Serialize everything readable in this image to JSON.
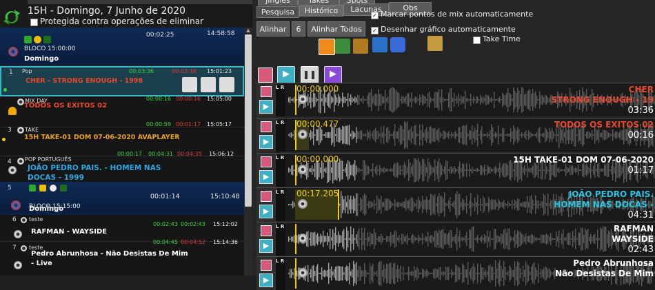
{
  "header": {
    "title": "15H - Domingo, 7 Junho de 2020",
    "protect_label": "Protegida contra operações de eliminar",
    "header_time": "14:58:58"
  },
  "playlist": [
    {
      "kind": "block",
      "dur": "00:02:25",
      "start": "15:00:00",
      "title": "BLOCO 15:00:00",
      "sub": "Domingo"
    },
    {
      "kind": "song",
      "num": "1",
      "cat": "Pop",
      "title": "CHER - STRONG ENOUGH - 1998",
      "color": "#e8492c",
      "t1": "00:03:36",
      "t2": "00:03:38",
      "t3": "15:01:23",
      "selected": true
    },
    {
      "kind": "song",
      "num": "2",
      "cat": "MIX DAY",
      "title": "TODOS OS EXITOS 02",
      "color": "#e8492c",
      "t1": "00:00:16",
      "t2": "00:00:16",
      "t3": "15:05:00"
    },
    {
      "kind": "song",
      "num": "3",
      "cat": "TAKE",
      "title": "15H TAKE-01 DOM 07-06-2020 AVAPLAYER",
      "color": "#e8a21c",
      "t1": "00:00:59",
      "t2": "00:01:17",
      "t3": "15:05:17"
    },
    {
      "kind": "song",
      "num": "4",
      "cat": "POP PORTUGUÊS",
      "title": "JOÃO PEDRO PAIS. - HOMEM NAS DOCAS - 1999",
      "color": "#27a8e0",
      "t1": "00:00:17",
      "t2": "00:04:31",
      "t3": "00:04:35",
      "t4": "15:06:12"
    },
    {
      "kind": "block",
      "num": "5",
      "dur": "00:01:14",
      "start": "15:10:48",
      "title": "BLOCO 15:15:00",
      "sub": "Domingo"
    },
    {
      "kind": "song",
      "num": "6",
      "cat": "teste",
      "title": "RAFMAN - WAYSIDE",
      "color": "#f0f0f0",
      "t1": "00:02:43",
      "t2": "00:02:43",
      "t3": "15:12:02"
    },
    {
      "kind": "song",
      "num": "7",
      "cat": "teste",
      "title": "Pedro Abrunhosa - Não Desistas De Mim - Live",
      "color": "#f0f0f0",
      "t1": "00:04:45",
      "t2": "00:04:52",
      "t3": "15:14:36"
    }
  ],
  "tabs_row1": [
    "Jingles",
    "Takes",
    "Spots"
  ],
  "tabs_row2": [
    "Pesquisa",
    "Histórico",
    "Lacunas",
    "Obs"
  ],
  "toolbar": {
    "align_label": "Alinhar",
    "align_count": "6",
    "align_all_label": "Alinhar Todos",
    "opt1": "Marcar pontos de mix automaticamente",
    "opt2": "Desenhar gráfico automaticamente",
    "take_time": "Take Time"
  },
  "tracks": [
    {
      "time": "00:00.000",
      "l1": "CHER",
      "l2": "STRONG ENOUGH - 19",
      "dur": "03:36",
      "color": "#e8492c",
      "icon": "disc"
    },
    {
      "time": "00:00.477",
      "l1": "TODOS OS EXITOS 02",
      "l2": "",
      "dur": "00:16",
      "color": "#e8492c",
      "icon": "bell"
    },
    {
      "time": "00:00.000",
      "l1": "15H TAKE-01 DOM 07-06-2020",
      "l2": "",
      "dur": "01:17",
      "color": "#ffffff",
      "icon": "disc"
    },
    {
      "time": "00:17.205",
      "l1": "JOÃO PEDRO PAIS.",
      "l2": "HOMEM NAS DOCAS -",
      "dur": "04:31",
      "color": "#27c3e0",
      "icon": "disc"
    },
    {
      "time": "",
      "l1": "RAFMAN",
      "l2": "WAYSIDE",
      "dur": "02:43",
      "color": "#ffffff",
      "icon": "disc"
    },
    {
      "time": "",
      "l1": "Pedro Abrunhosa",
      "l2": "Não Desistas De Mim",
      "dur": "",
      "color": "#ffffff",
      "icon": "disc"
    }
  ],
  "lr_label": "L R",
  "colors": {
    "accent": "#35b8c9",
    "time_yellow": "#f2d000",
    "green": "#3ad63a",
    "red": "#e23b3b"
  }
}
